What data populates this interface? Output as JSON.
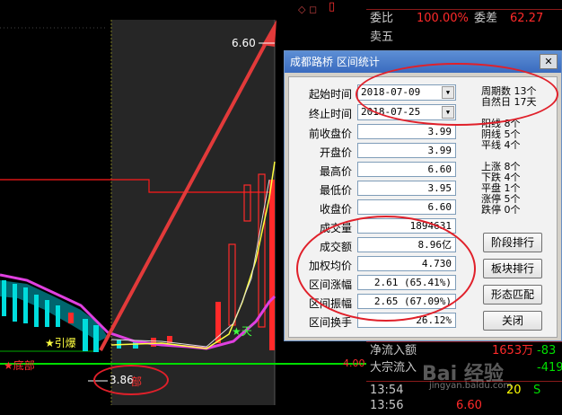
{
  "window": {
    "title": "成都路桥 区间统计",
    "close": "✕"
  },
  "chart": {
    "price_top": "6.60",
    "price_low": "3.86",
    "axis_price": "4.00",
    "label_yinbao": "★引爆",
    "label_dibu": "★底部",
    "label_tian": "★天",
    "label_bu": "部"
  },
  "fields": {
    "start_label": "起始时间",
    "start_value": "2018-07-09",
    "end_label": "终止时间",
    "end_value": "2018-07-25",
    "prev_close_label": "前收盘价",
    "prev_close": "3.99",
    "open_label": "开盘价",
    "open": "3.99",
    "high_label": "最高价",
    "high": "6.60",
    "low_label": "最低价",
    "low": "3.95",
    "close_label": "收盘价",
    "close": "6.60",
    "volume_label": "成交量",
    "volume": "1894631",
    "amount_label": "成交额",
    "amount": "8.96亿",
    "wavg_label": "加权均价",
    "wavg": "4.730",
    "change_label": "区间涨幅",
    "change": "2.61 (65.41%)",
    "amplitude_label": "区间振幅",
    "amplitude": "2.65 (67.09%)",
    "turnover_label": "区间换手",
    "turnover": "26.12%"
  },
  "stats": {
    "periods": "周期数 13个",
    "natural_days": "自然日 17天",
    "yang": "阳线 8个",
    "yin": "阴线 5个",
    "flat": "平线 4个",
    "up": "上涨 8个",
    "down": "下跌 4个",
    "level": "平盘 1个",
    "limit_up": "涨停 5个",
    "limit_down": "跌停 0个"
  },
  "buttons": {
    "stage_rank": "阶段排行",
    "sector_rank": "板块排行",
    "pattern_match": "形态匹配",
    "close": "关闭"
  },
  "quote": {
    "weibi_label": "委比",
    "weibi_value": "100.00%",
    "weicha_label": "委差",
    "weicha_value": "62.27",
    "sell5": "卖五",
    "net_inflow_label": "净流入额",
    "net_inflow_value": "1653万",
    "net_inflow_pct": "-83",
    "bulk_inflow_label": "大宗流入",
    "bulk_inflow_value": "-419",
    "tick_time_1": "13:54",
    "tick_vol_1": "20",
    "tick_flag_1": "S",
    "tick_time_2": "13:56",
    "tick_price_2": "6.60",
    "watermark": "Bai 经验",
    "watermark_url": "jingyan.baidu.com"
  }
}
